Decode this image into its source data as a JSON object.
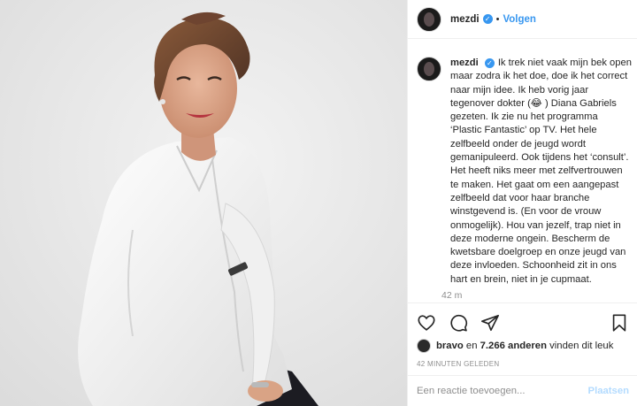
{
  "header": {
    "username": "mezdi",
    "separator": "•",
    "follow_label": "Volgen"
  },
  "post": {
    "username": "mezdi",
    "caption": "Ik trek niet vaak mijn bek open maar zodra ik het doe, doe ik het correct naar mijn idee. Ik heb vorig jaar tegenover dokter (😂 ) Diana Gabriels gezeten. Ik zie nu het programma ‘Plastic Fantastic’ op TV. Het hele zelfbeeld onder de jeugd wordt gemanipuleerd. Ook tijdens het ‘consult’. Het heeft niks meer met zelfvertrouwen te maken. Het gaat om een aangepast zelfbeeld dat voor haar branche winstgevend is. (En voor de vrouw onmogelijk). Hou van jezelf, trap niet in deze moderne ongein. Bescherm de kwetsbare doelgroep en onze jeugd van deze invloeden. Schoonheid zit in ons hart en brein, niet in je cupmaat.",
    "time_ago": "42 m"
  },
  "likes": {
    "first_liker": "bravo",
    "connector": "en",
    "count_text": "7.266 anderen",
    "suffix": "vinden dit leuk"
  },
  "post_time": "42 MINUTEN GELEDEN",
  "comment_box": {
    "placeholder": "Een reactie toevoegen...",
    "post_label": "Plaatsen"
  },
  "colors": {
    "link_blue": "#3897f0",
    "verified_blue": "#3897f0",
    "post_disabled": "#b3dbff",
    "muted_text": "#8e8e8e"
  },
  "icons": [
    "heart-icon",
    "comment-icon",
    "share-icon",
    "bookmark-icon",
    "verified-badge-icon"
  ]
}
